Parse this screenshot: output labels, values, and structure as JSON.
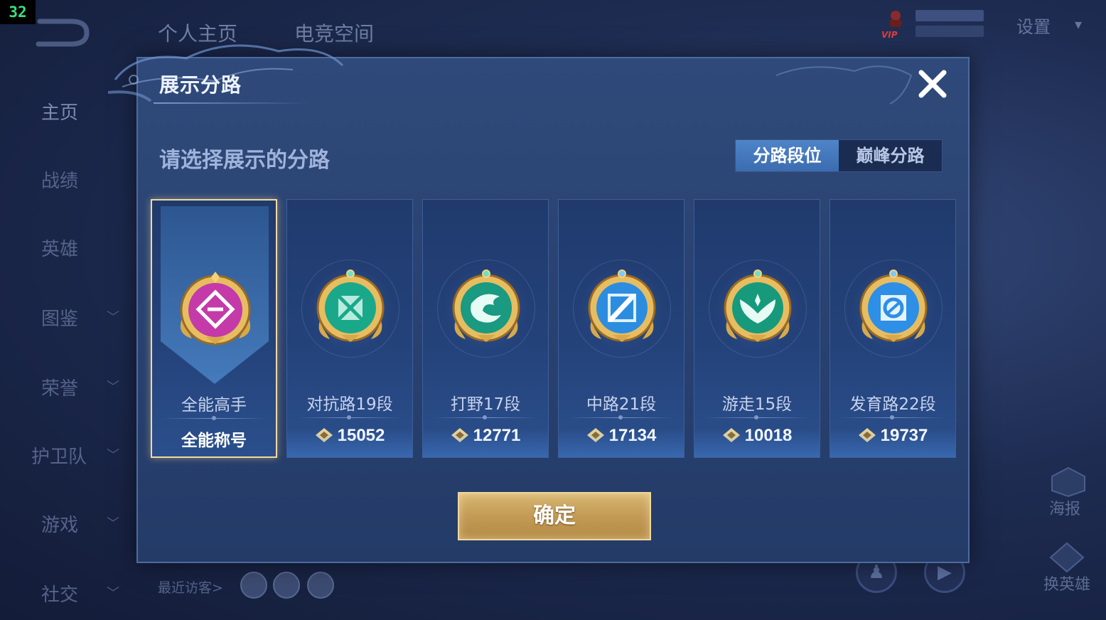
{
  "fps_counter": "32",
  "top_nav": {
    "tabs": [
      "个人主页",
      "电竞空间"
    ]
  },
  "vip_badge": "VIP",
  "settings_label": "设置",
  "sidebar": {
    "items": [
      {
        "label": "主页",
        "has_chevron": false
      },
      {
        "label": "战绩",
        "has_chevron": false
      },
      {
        "label": "英雄",
        "has_chevron": false
      },
      {
        "label": "图鉴",
        "has_chevron": true
      },
      {
        "label": "荣誉",
        "has_chevron": true
      },
      {
        "label": "护卫队",
        "has_chevron": true
      },
      {
        "label": "游戏",
        "has_chevron": true
      },
      {
        "label": "社交",
        "has_chevron": true
      }
    ]
  },
  "visitors_label": "最近访客>",
  "right_actions": [
    {
      "label": "海报"
    },
    {
      "label": "换英雄"
    }
  ],
  "modal": {
    "title": "展示分路",
    "prompt": "请选择展示的分路",
    "segments": [
      {
        "label": "分路段位",
        "active": true
      },
      {
        "label": "巅峰分路",
        "active": false
      }
    ],
    "cards": [
      {
        "name": "全能高手",
        "subtitle": "全能称号",
        "score": "",
        "selected": true,
        "emblem": "all-round-emblem-icon",
        "color": "#c43aa8"
      },
      {
        "name": "对抗路19段",
        "subtitle": "",
        "score": "15052",
        "selected": false,
        "emblem": "clash-lane-emblem-icon",
        "color": "#1aa88a"
      },
      {
        "name": "打野17段",
        "subtitle": "",
        "score": "12771",
        "selected": false,
        "emblem": "jungle-emblem-icon",
        "color": "#1a9a80"
      },
      {
        "name": "中路21段",
        "subtitle": "",
        "score": "17134",
        "selected": false,
        "emblem": "mid-lane-emblem-icon",
        "color": "#2c8de0"
      },
      {
        "name": "游走15段",
        "subtitle": "",
        "score": "10018",
        "selected": false,
        "emblem": "roam-emblem-icon",
        "color": "#179a7c"
      },
      {
        "name": "发育路22段",
        "subtitle": "",
        "score": "19737",
        "selected": false,
        "emblem": "farm-lane-emblem-icon",
        "color": "#2d8fe6"
      }
    ],
    "confirm_label": "确定"
  }
}
